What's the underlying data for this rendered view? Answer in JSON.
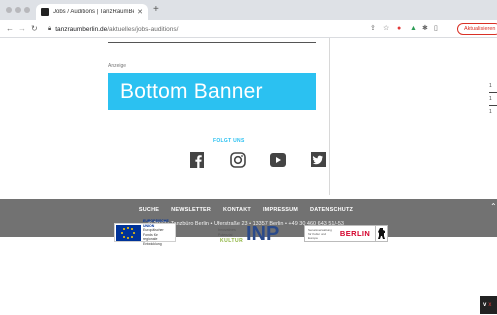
{
  "browser": {
    "tab": {
      "title": "Jobs / Auditions | TanzRaumBerlin"
    },
    "address": {
      "host": "tanzraumberlin.de",
      "path": "/aktuelles/jobs-auditions/"
    },
    "update_label": "Aktualisieren"
  },
  "page": {
    "ad_label": "Anzeige",
    "banner_text": "Bottom Banner",
    "follow_label": "FOLGT UNS",
    "social": [
      "facebook",
      "instagram",
      "youtube",
      "twitter"
    ]
  },
  "footer": {
    "nav": [
      "SUCHE",
      "NEWSLETTER",
      "KONTAKT",
      "IMPRESSUM",
      "DATENSCHUTZ"
    ],
    "address": "© 2022  •  Tanzbüro Berlin  •  Uferstraße 23  •  13357 Berlin  •  +49 30 460 643 51/-53"
  },
  "sponsors": {
    "eu": {
      "title": "EUROPÄISCHE UNION",
      "line1": "Europäischer Fonds für",
      "line2": "regionale Entwicklung"
    },
    "inp": {
      "line1": "Innovatives",
      "line2": "Potenzial",
      "kultur": "KULTUR",
      "logo": "INP"
    },
    "berlin": {
      "line1": "Senatsverwaltung",
      "line2": "für Kultur und Europa",
      "word": "BERLIN"
    }
  },
  "colors": {
    "accent": "#2bc1f1",
    "footer": "#727272",
    "berlin_red": "#d4002b"
  }
}
